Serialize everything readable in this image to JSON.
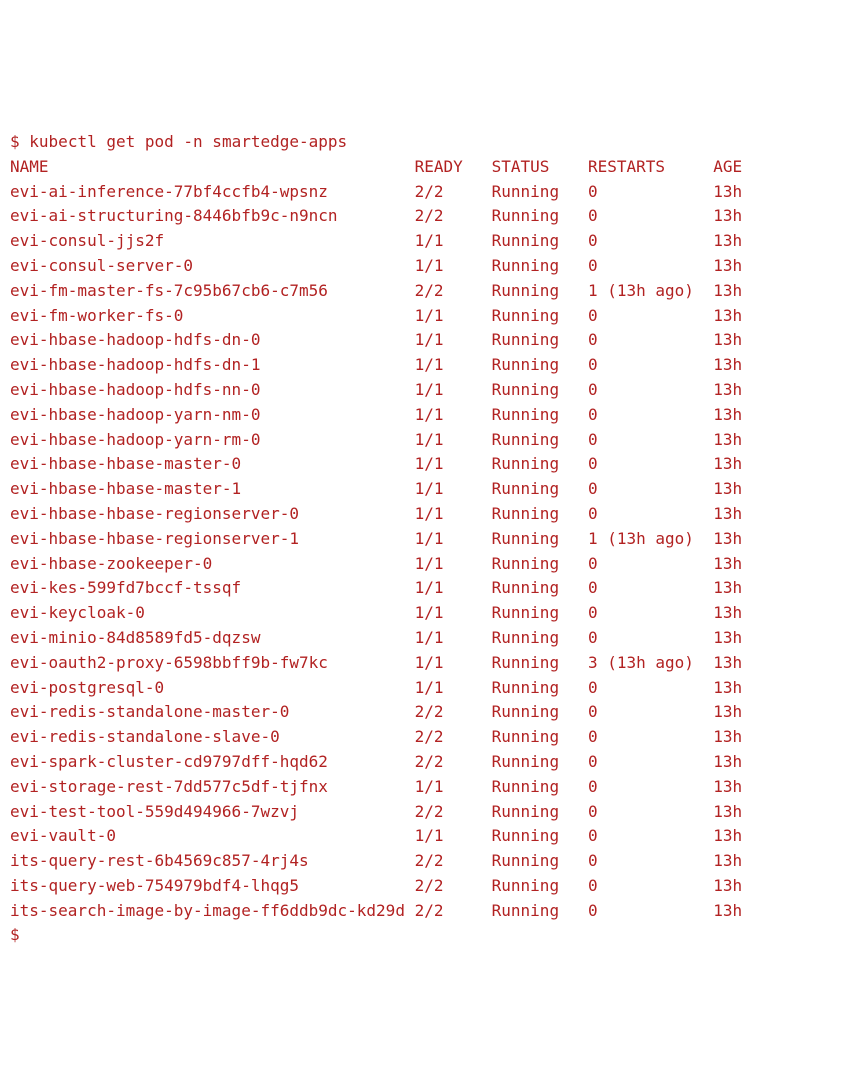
{
  "prompt": "$",
  "command": "kubectl get pod -n smartedge-apps",
  "header": {
    "name": "NAME",
    "ready": "READY",
    "status": "STATUS",
    "restarts": "RESTARTS",
    "age": "AGE"
  },
  "rows": [
    {
      "name": "evi-ai-inference-77bf4ccfb4-wpsnz",
      "ready": "2/2",
      "status": "Running",
      "restarts": "0",
      "age": "13h"
    },
    {
      "name": "evi-ai-structuring-8446bfb9c-n9ncn",
      "ready": "2/2",
      "status": "Running",
      "restarts": "0",
      "age": "13h"
    },
    {
      "name": "evi-consul-jjs2f",
      "ready": "1/1",
      "status": "Running",
      "restarts": "0",
      "age": "13h"
    },
    {
      "name": "evi-consul-server-0",
      "ready": "1/1",
      "status": "Running",
      "restarts": "0",
      "age": "13h"
    },
    {
      "name": "evi-fm-master-fs-7c95b67cb6-c7m56",
      "ready": "2/2",
      "status": "Running",
      "restarts": "1 (13h ago)",
      "age": "13h"
    },
    {
      "name": "evi-fm-worker-fs-0",
      "ready": "1/1",
      "status": "Running",
      "restarts": "0",
      "age": "13h"
    },
    {
      "name": "evi-hbase-hadoop-hdfs-dn-0",
      "ready": "1/1",
      "status": "Running",
      "restarts": "0",
      "age": "13h"
    },
    {
      "name": "evi-hbase-hadoop-hdfs-dn-1",
      "ready": "1/1",
      "status": "Running",
      "restarts": "0",
      "age": "13h"
    },
    {
      "name": "evi-hbase-hadoop-hdfs-nn-0",
      "ready": "1/1",
      "status": "Running",
      "restarts": "0",
      "age": "13h"
    },
    {
      "name": "evi-hbase-hadoop-yarn-nm-0",
      "ready": "1/1",
      "status": "Running",
      "restarts": "0",
      "age": "13h"
    },
    {
      "name": "evi-hbase-hadoop-yarn-rm-0",
      "ready": "1/1",
      "status": "Running",
      "restarts": "0",
      "age": "13h"
    },
    {
      "name": "evi-hbase-hbase-master-0",
      "ready": "1/1",
      "status": "Running",
      "restarts": "0",
      "age": "13h"
    },
    {
      "name": "evi-hbase-hbase-master-1",
      "ready": "1/1",
      "status": "Running",
      "restarts": "0",
      "age": "13h"
    },
    {
      "name": "evi-hbase-hbase-regionserver-0",
      "ready": "1/1",
      "status": "Running",
      "restarts": "0",
      "age": "13h"
    },
    {
      "name": "evi-hbase-hbase-regionserver-1",
      "ready": "1/1",
      "status": "Running",
      "restarts": "1 (13h ago)",
      "age": "13h"
    },
    {
      "name": "evi-hbase-zookeeper-0",
      "ready": "1/1",
      "status": "Running",
      "restarts": "0",
      "age": "13h"
    },
    {
      "name": "evi-kes-599fd7bccf-tssqf",
      "ready": "1/1",
      "status": "Running",
      "restarts": "0",
      "age": "13h"
    },
    {
      "name": "evi-keycloak-0",
      "ready": "1/1",
      "status": "Running",
      "restarts": "0",
      "age": "13h"
    },
    {
      "name": "evi-minio-84d8589fd5-dqzsw",
      "ready": "1/1",
      "status": "Running",
      "restarts": "0",
      "age": "13h"
    },
    {
      "name": "evi-oauth2-proxy-6598bbff9b-fw7kc",
      "ready": "1/1",
      "status": "Running",
      "restarts": "3 (13h ago)",
      "age": "13h"
    },
    {
      "name": "evi-postgresql-0",
      "ready": "1/1",
      "status": "Running",
      "restarts": "0",
      "age": "13h"
    },
    {
      "name": "evi-redis-standalone-master-0",
      "ready": "2/2",
      "status": "Running",
      "restarts": "0",
      "age": "13h"
    },
    {
      "name": "evi-redis-standalone-slave-0",
      "ready": "2/2",
      "status": "Running",
      "restarts": "0",
      "age": "13h"
    },
    {
      "name": "evi-spark-cluster-cd9797dff-hqd62",
      "ready": "2/2",
      "status": "Running",
      "restarts": "0",
      "age": "13h"
    },
    {
      "name": "evi-storage-rest-7dd577c5df-tjfnx",
      "ready": "1/1",
      "status": "Running",
      "restarts": "0",
      "age": "13h"
    },
    {
      "name": "evi-test-tool-559d494966-7wzvj",
      "ready": "2/2",
      "status": "Running",
      "restarts": "0",
      "age": "13h"
    },
    {
      "name": "evi-vault-0",
      "ready": "1/1",
      "status": "Running",
      "restarts": "0",
      "age": "13h"
    },
    {
      "name": "its-query-rest-6b4569c857-4rj4s",
      "ready": "2/2",
      "status": "Running",
      "restarts": "0",
      "age": "13h"
    },
    {
      "name": "its-query-web-754979bdf4-lhqg5",
      "ready": "2/2",
      "status": "Running",
      "restarts": "0",
      "age": "13h"
    },
    {
      "name": "its-search-image-by-image-ff6ddb9dc-kd29d",
      "ready": "2/2",
      "status": "Running",
      "restarts": "0",
      "age": "13h"
    }
  ],
  "widths": {
    "name": 42,
    "ready": 8,
    "status": 10,
    "restarts": 13
  },
  "trailing_prompt": "$"
}
